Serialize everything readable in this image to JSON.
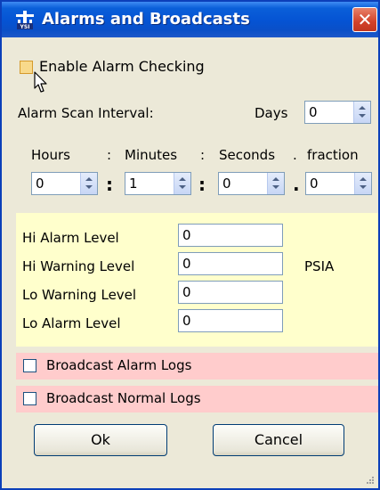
{
  "window": {
    "title": "Alarms and Broadcasts",
    "close_glyph": "✕"
  },
  "enable_alarm": {
    "label": "Enable Alarm Checking",
    "checked": false
  },
  "scan": {
    "label": "Alarm Scan Interval:",
    "days_label": "Days",
    "days_value": "0",
    "headers": {
      "hours": "Hours",
      "minutes": "Minutes",
      "seconds": "Seconds",
      "fraction": "fraction"
    },
    "header_seps": [
      ":",
      ":",
      "."
    ],
    "values": {
      "hours": "0",
      "minutes": "1",
      "seconds": "0",
      "fraction": "0"
    },
    "value_seps": [
      ":",
      ":",
      "."
    ]
  },
  "levels": {
    "hi_alarm": {
      "label": "Hi Alarm Level",
      "value": "0"
    },
    "hi_warning": {
      "label": "Hi Warning Level",
      "value": "0"
    },
    "lo_warning": {
      "label": "Lo Warning Level",
      "value": "0"
    },
    "lo_alarm": {
      "label": "Lo Alarm Level",
      "value": "0"
    },
    "unit": "PSIA"
  },
  "broadcast": {
    "alarm_logs": {
      "label": "Broadcast Alarm Logs",
      "checked": false
    },
    "normal_logs": {
      "label": "Broadcast Normal Logs",
      "checked": false
    }
  },
  "buttons": {
    "ok": "Ok",
    "cancel": "Cancel"
  },
  "icons": {
    "app": "ysi-app-icon",
    "close": "close-icon",
    "cursor": "mouse-pointer-icon",
    "grip": "resize-grip-icon",
    "spin": "spin-arrows-icon"
  },
  "colors": {
    "titlebar": "#0553d3",
    "yellow_panel": "#ffffcc",
    "pink_panel": "#ffcccc",
    "close": "#d2422a"
  }
}
